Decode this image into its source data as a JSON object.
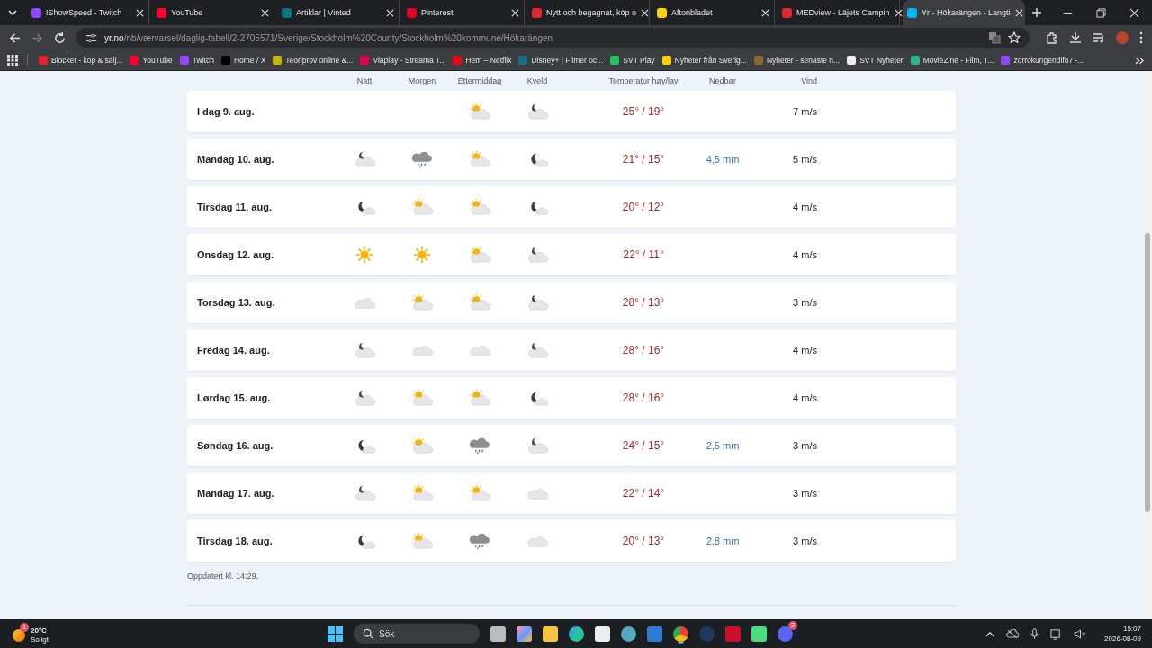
{
  "tabs": [
    {
      "title": "IShowSpeed - Twitch",
      "color": "#9146ff",
      "selected": false
    },
    {
      "title": "YouTube",
      "color": "#ff0033",
      "selected": false
    },
    {
      "title": "Artiklar | Vinted",
      "color": "#09777f",
      "selected": false
    },
    {
      "title": "Pinterest",
      "color": "#e60023",
      "selected": false
    },
    {
      "title": "Nytt och begagnat, köp o",
      "color": "#e3262e",
      "selected": false
    },
    {
      "title": "Aftonbladet",
      "color": "#f5d400",
      "selected": false
    },
    {
      "title": "MEDview - Läjets Campin",
      "color": "#e3262e",
      "selected": false
    },
    {
      "title": "Yr - Hökarängen - Langti",
      "color": "#00b8f1",
      "selected": true
    }
  ],
  "address": {
    "host": "yr.no",
    "path": "/nb/værvarsel/daglig-tabell/2-2705571/Sverige/Stockholm%20County/Stockholm%20kommune/Hökarängen"
  },
  "bookmarks": [
    {
      "label": "Blocket - köp & sälj...",
      "color": "#e3262e"
    },
    {
      "label": "YouTube",
      "color": "#ff0033"
    },
    {
      "label": "Twitch",
      "color": "#9146ff"
    },
    {
      "label": "Home / X",
      "color": "#000000"
    },
    {
      "label": "Teoriprov online &...",
      "color": "#c9b400"
    },
    {
      "label": "Viaplay - Streama T...",
      "color": "#e5004c"
    },
    {
      "label": "Hem – Netflix",
      "color": "#e50914"
    },
    {
      "label": "Disney+ | Filmer oc...",
      "color": "#1b6f8a"
    },
    {
      "label": "SVT Play",
      "color": "#22c55e"
    },
    {
      "label": "Nyheter från Sverig...",
      "color": "#f5d400"
    },
    {
      "label": "Nyheter - senaste n...",
      "color": "#8a6a2a"
    },
    {
      "label": "SVT Nyheter",
      "color": "#eeeeee"
    },
    {
      "label": "MovieZine - Film, T...",
      "color": "#2fb58a"
    },
    {
      "label": "zorrokungendif87 -...",
      "color": "#9146ff"
    }
  ],
  "table": {
    "columns": [
      "Natt",
      "Morgen",
      "Ettermiddag",
      "Kveld",
      "Temperatur høy/lav",
      "Nedbør",
      "Vind"
    ],
    "rows": [
      {
        "day": "I dag 9. aug.",
        "ettermiddag": {
          "kind": "sun-cloud"
        },
        "kveld": {
          "kind": "moon-cloud"
        },
        "temp": "25° / 19°",
        "wind": "7 m/s"
      },
      {
        "day": "Mandag 10. aug.",
        "natt": {
          "kind": "moon-cloud"
        },
        "morgen": {
          "kind": "rain"
        },
        "ettermiddag": {
          "kind": "sun-cloud"
        },
        "kveld": {
          "kind": "moon-dark"
        },
        "temp": "21° / 15°",
        "precip": "4,5 mm",
        "wind": "5 m/s"
      },
      {
        "day": "Tirsdag 11. aug.",
        "natt": {
          "kind": "moon-dark"
        },
        "morgen": {
          "kind": "sun-cloud"
        },
        "ettermiddag": {
          "kind": "sun-cloud"
        },
        "kveld": {
          "kind": "moon-dark"
        },
        "temp": "20° / 12°",
        "wind": "4 m/s"
      },
      {
        "day": "Onsdag 12. aug.",
        "natt": {
          "kind": "sun"
        },
        "morgen": {
          "kind": "sun"
        },
        "ettermiddag": {
          "kind": "sun-cloud"
        },
        "kveld": {
          "kind": "moon-cloud"
        },
        "temp": "22° / 11°",
        "wind": "4 m/s"
      },
      {
        "day": "Torsdag 13. aug.",
        "natt": {
          "kind": "cloud"
        },
        "morgen": {
          "kind": "sun-cloud"
        },
        "ettermiddag": {
          "kind": "sun-cloud"
        },
        "kveld": {
          "kind": "moon-cloud"
        },
        "temp": "28° / 13°",
        "wind": "3 m/s"
      },
      {
        "day": "Fredag 14. aug.",
        "natt": {
          "kind": "moon-cloud"
        },
        "morgen": {
          "kind": "cloud"
        },
        "ettermiddag": {
          "kind": "cloud"
        },
        "kveld": {
          "kind": "moon-cloud"
        },
        "temp": "28° / 16°",
        "wind": "4 m/s"
      },
      {
        "day": "Lørdag 15. aug.",
        "natt": {
          "kind": "moon-cloud"
        },
        "morgen": {
          "kind": "sun-cloud"
        },
        "ettermiddag": {
          "kind": "sun-cloud"
        },
        "kveld": {
          "kind": "moon-dark"
        },
        "temp": "28° / 16°",
        "wind": "4 m/s"
      },
      {
        "day": "Søndag 16. aug.",
        "natt": {
          "kind": "moon-dark"
        },
        "morgen": {
          "kind": "sun-cloud"
        },
        "ettermiddag": {
          "kind": "rain"
        },
        "kveld": {
          "kind": "moon-cloud"
        },
        "temp": "24° / 15°",
        "precip": "2,5 mm",
        "wind": "3 m/s"
      },
      {
        "day": "Mandag 17. aug.",
        "natt": {
          "kind": "moon-cloud"
        },
        "morgen": {
          "kind": "sun-cloud"
        },
        "ettermiddag": {
          "kind": "sun-cloud"
        },
        "kveld": {
          "kind": "cloud"
        },
        "temp": "22° / 14°",
        "wind": "3 m/s"
      },
      {
        "day": "Tirsdag 18. aug.",
        "natt": {
          "kind": "moon-dark"
        },
        "morgen": {
          "kind": "sun-cloud"
        },
        "ettermiddag": {
          "kind": "rain"
        },
        "kveld": {
          "kind": "cloud"
        },
        "temp": "20° / 13°",
        "precip": "2,8 mm",
        "wind": "3 m/s"
      }
    ],
    "updated": "Oppdatert kl. 14:29."
  },
  "taskbar": {
    "weather": {
      "temp": "20°C",
      "condition": "Soligt",
      "badge": "1"
    },
    "search": {
      "placeholder": "Sök"
    },
    "discord_badge": "2",
    "time": "15:07",
    "date": "2026-08-09"
  }
}
